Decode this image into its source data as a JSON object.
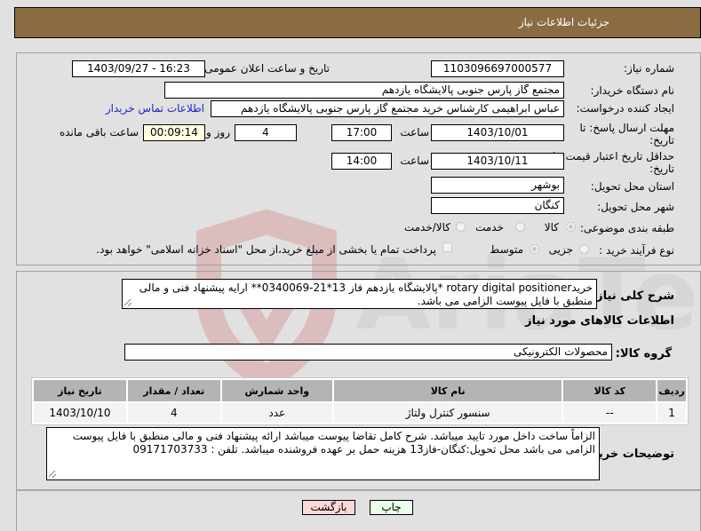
{
  "header": {
    "title": "جزئیات اطلاعات نیاز"
  },
  "fields": {
    "need_number_label": "شماره نیاز:",
    "need_number": "1103096697000577",
    "announce_label": "تاریخ و ساعت اعلان عمومی:",
    "announce_value": "1403/09/27 - 16:23",
    "buyer_org_label": "نام دستگاه خریدار:",
    "buyer_org": "مجتمع گاز پارس جنوبی  پالایشگاه یازدهم",
    "creator_label": "ایجاد کننده درخواست:",
    "creator": "عباس ابراهیمی کارشناس خرید مجتمع گاز پارس جنوبی  پالایشگاه یازدهم",
    "contact_link": "اطلاعات تماس خریدار",
    "reply_deadline_label": "مهلت ارسال پاسخ: تا تاریخ:",
    "reply_date": "1403/10/01",
    "time_label": "ساعت",
    "reply_time": "17:00",
    "days": "4",
    "days_label": "روز و",
    "remaining_time": "00:09:14",
    "remaining_label": "ساعت باقی مانده",
    "price_validity_label": "حداقل تاریخ اعتبار قیمت: تا تاریخ:",
    "price_validity_date": "1403/10/11",
    "price_validity_time": "14:00",
    "province_label": "استان محل تحویل:",
    "province": "بوشهر",
    "city_label": "شهر محل تحویل:",
    "city": "کنگان",
    "category_label": "طبقه بندی موضوعی:",
    "category_options": [
      "کالا",
      "خدمت",
      "کالا/خدمت"
    ],
    "category_selected": "کالا",
    "process_label": "نوع فرآیند خرید :",
    "process_options": [
      "جزیی",
      "متوسط"
    ],
    "process_selected": "متوسط",
    "payment_note": "پرداخت تمام یا بخشی از مبلغ خرید،از محل \"اسناد خزانه اسلامی\" خواهد بود."
  },
  "description": {
    "label": "شرح کلی نیاز:",
    "text": "خریدrotary digital positioner *پالایشگاه یازدهم فاز 13*21-0340069** ارایه پیشنهاد فنی و مالی منطبق با فایل پیوست الزامی می باشد."
  },
  "goods": {
    "section_title": "اطلاعات کالاهای مورد نیاز",
    "group_label": "گروه کالا:",
    "group_value": "محصولات الکترونیکی",
    "columns": [
      "ردیف",
      "کد کالا",
      "نام کالا",
      "واحد شمارش",
      "تعداد / مقدار",
      "تاریخ نیاز"
    ],
    "rows": [
      [
        "1",
        "--",
        "سنسور کنترل ولتاژ",
        "عدد",
        "4",
        "1403/10/10"
      ]
    ]
  },
  "buyer_notes": {
    "label": "توضیحات خریدار:",
    "text": "الزاماً ساخت داخل مورد تایید میباشد. شرح کامل تقاضا پیوست میباشد ارائه پیشنهاد فنی و مالی منطبق با فایل پیوست الزامی می باشد محل تحویل:کنگان-فاز13 هزینه حمل بر عهده فروشنده میباشد. تلفن : 09171703733"
  },
  "buttons": {
    "print": "چاپ",
    "back": "بازگشت"
  },
  "watermark": {
    "text": "AriaTender.neT"
  }
}
